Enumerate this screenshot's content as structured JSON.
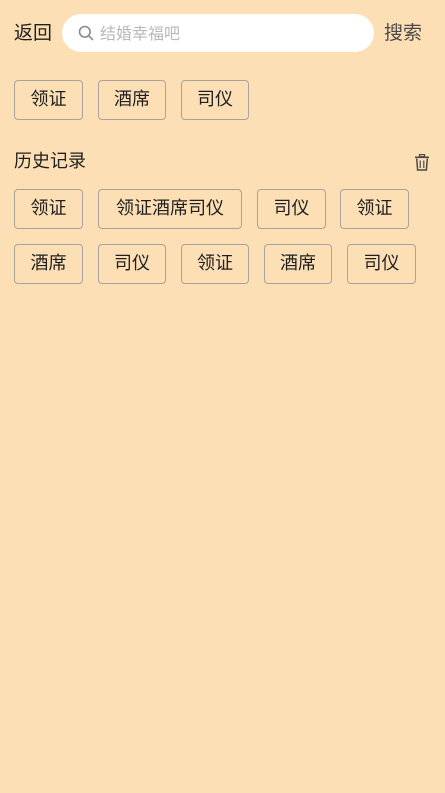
{
  "header": {
    "back_label": "返回",
    "search_placeholder": "结婚幸福吧",
    "search_value": "",
    "search_label": "搜索"
  },
  "hot_tags": [
    "领证",
    "酒席",
    "司仪"
  ],
  "history": {
    "title": "历史记录",
    "items": [
      "领证",
      "领证酒席司仪",
      "司仪",
      "领证",
      "酒席",
      "司仪",
      "领证",
      "酒席",
      "司仪"
    ]
  },
  "colors": {
    "background": "#FDDFB6",
    "search_box": "#FFFFFF",
    "tag_border": "#A9A39B",
    "placeholder": "#B9B9B9"
  },
  "icons": {
    "search": "search-icon",
    "trash": "trash-icon"
  }
}
